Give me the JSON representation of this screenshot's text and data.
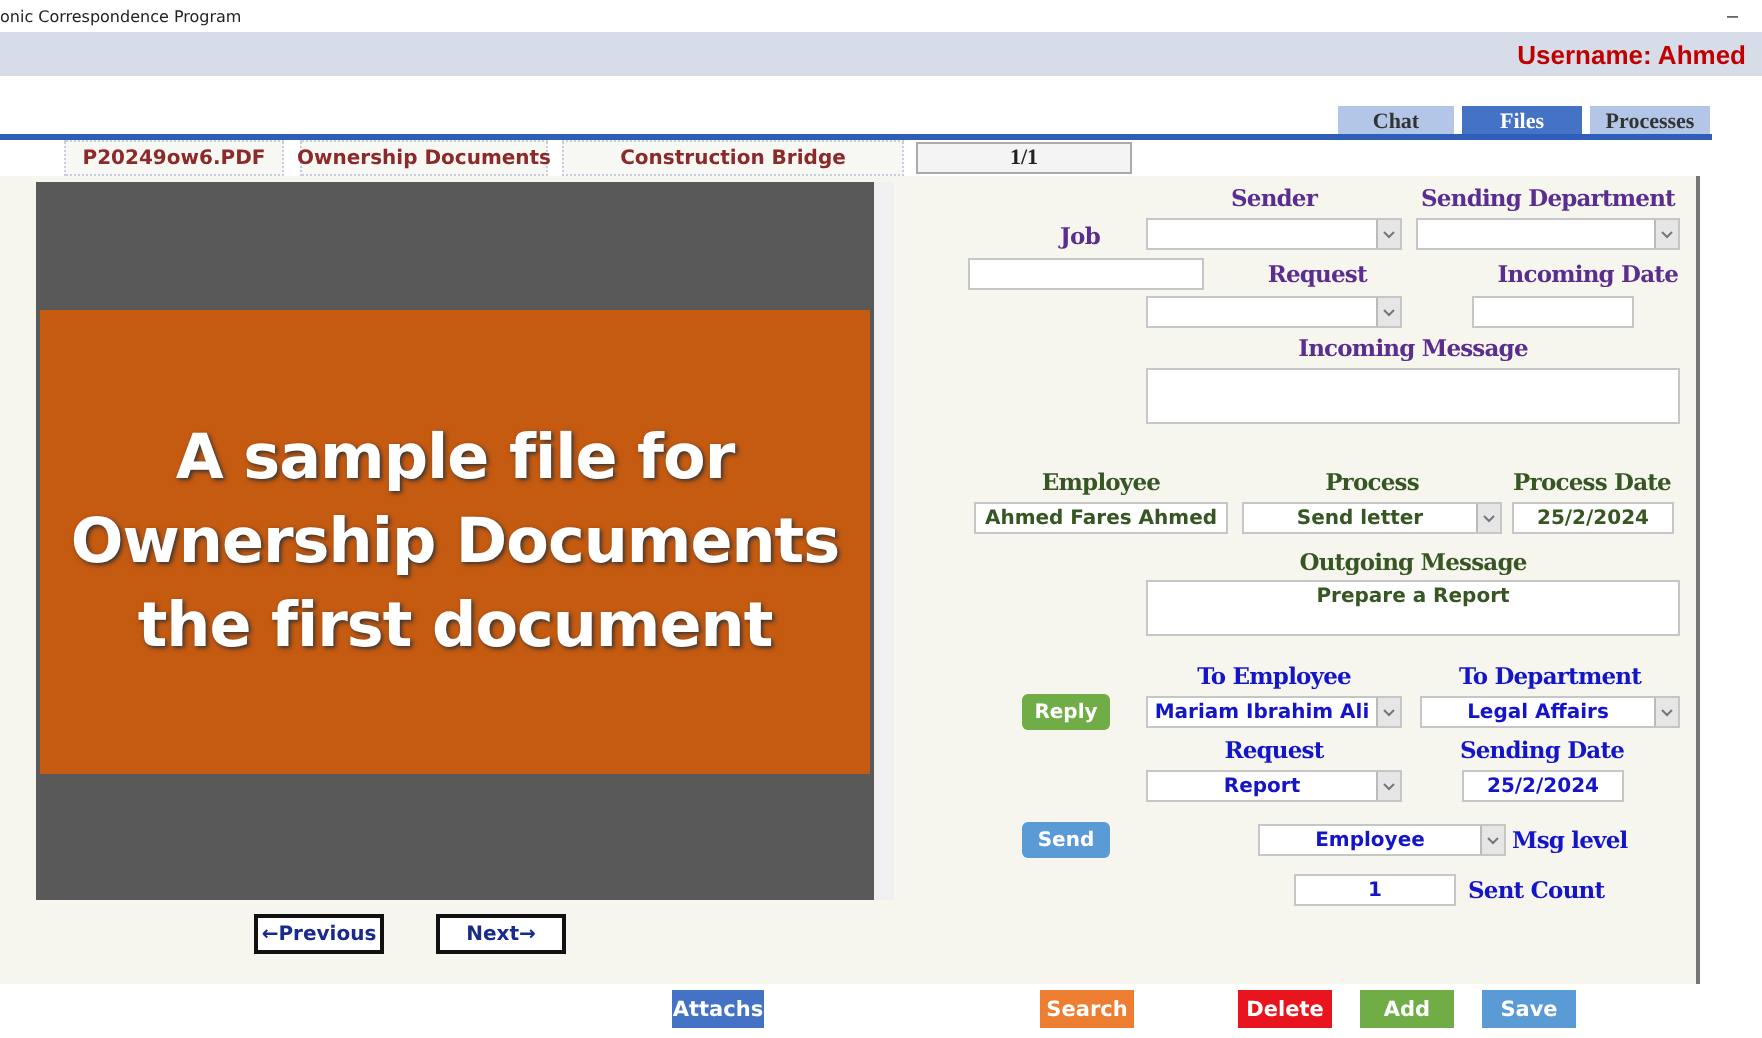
{
  "window": {
    "title": "onic Correspondence Program",
    "minimize": "–"
  },
  "user": {
    "label": "Username: Ahmed"
  },
  "tabs": [
    {
      "label": "Chat",
      "selected": false
    },
    {
      "label": "Files",
      "selected": true
    },
    {
      "label": "Processes",
      "selected": false
    }
  ],
  "file_bar": {
    "file_name": "P20249ow6.PDF",
    "category": "Ownership Documents",
    "project": "Construction Bridge",
    "page": "1/1"
  },
  "preview": {
    "kind": "document",
    "lines": [
      "A sample file for",
      "Ownership Documents",
      "the first document"
    ]
  },
  "pager": {
    "previous": "←Previous",
    "next": "Next→"
  },
  "incoming": {
    "job": {
      "label": "Job",
      "kind": "input"
    },
    "sender": {
      "label": "Sender",
      "kind": "select"
    },
    "sending_department": {
      "label": "Sending Department",
      "kind": "select"
    },
    "request": {
      "label": "Request",
      "kind": "select"
    },
    "incoming_date": {
      "label": "Incoming Date",
      "kind": "input"
    },
    "incoming_message": {
      "label": "Incoming Message",
      "kind": "textarea"
    }
  },
  "process": {
    "employee": {
      "label": "Employee",
      "kind": "input",
      "value": "Ahmed Fares Ahmed"
    },
    "process": {
      "label": "Process",
      "kind": "select",
      "value": "Send letter"
    },
    "process_date": {
      "label": "Process Date",
      "kind": "input",
      "value": "25/2/2024"
    },
    "outgoing_message": {
      "label": "Outgoing Message",
      "kind": "textarea",
      "value": "Prepare a Report"
    }
  },
  "send": {
    "reply_button": "Reply",
    "send_button": "Send",
    "to_employee": {
      "label": "To Employee",
      "kind": "select",
      "value": "Mariam Ibrahim Ali"
    },
    "to_department": {
      "label": "To Department",
      "kind": "select",
      "value": "Legal Affairs"
    },
    "request": {
      "label": "Request",
      "kind": "select",
      "value": "Report"
    },
    "sending_date": {
      "label": "Sending Date",
      "kind": "input",
      "value": "25/2/2024"
    },
    "msg_level": {
      "label": "Msg level",
      "kind": "select",
      "value": "Employee"
    },
    "sent_count": {
      "label": "Sent Count",
      "kind": "input",
      "value": "1"
    }
  },
  "actions": [
    {
      "label": "Attachs",
      "color": "#4472c4"
    },
    {
      "label": "Search",
      "color": "#ed7d31"
    },
    {
      "label": "Delete",
      "color": "#e8141e"
    },
    {
      "label": "Add",
      "color": "#70ad47"
    },
    {
      "label": "Save",
      "color": "#5b9bd5"
    }
  ]
}
